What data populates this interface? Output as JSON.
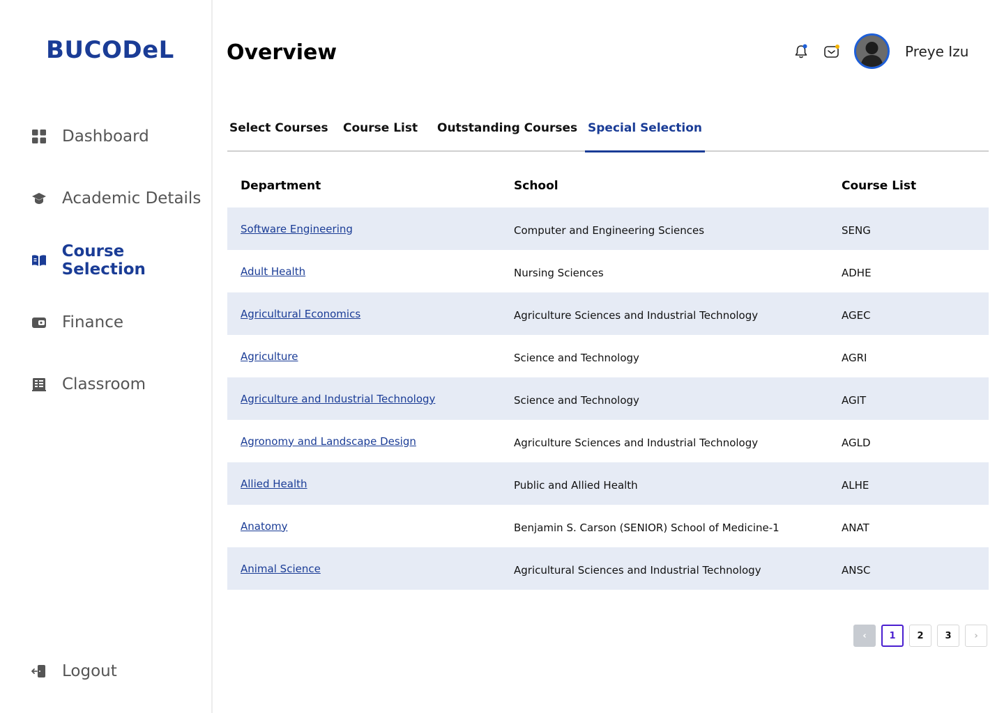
{
  "app": {
    "logo": "BUCODeL"
  },
  "sidebar": {
    "items": [
      {
        "label": "Dashboard",
        "icon": "grid-icon"
      },
      {
        "label": "Academic Details",
        "icon": "graduation-cap-icon"
      },
      {
        "label": "Course Selection",
        "icon": "open-book-icon",
        "active": true
      },
      {
        "label": "Finance",
        "icon": "wallet-icon"
      },
      {
        "label": "Classroom",
        "icon": "building-icon"
      }
    ],
    "logout": {
      "label": "Logout",
      "icon": "logout-icon"
    }
  },
  "header": {
    "title": "Overview",
    "user_name": "Preye Izu",
    "notification_dot_color": "#1e5fd8",
    "mail_dot_color": "#f5b400"
  },
  "tabs": [
    {
      "label": "Select Courses"
    },
    {
      "label": "Course List"
    },
    {
      "label": "Outstanding Courses"
    },
    {
      "label": "Special Selection",
      "active": true
    }
  ],
  "table": {
    "columns": [
      "Department",
      "School",
      "Course List"
    ],
    "rows": [
      {
        "department": "Software Engineering",
        "school": "Computer and Engineering Sciences",
        "course": "SENG"
      },
      {
        "department": "Adult Health",
        "school": "Nursing Sciences",
        "course": "ADHE"
      },
      {
        "department": "Agricultural Economics",
        "school": "Agriculture Sciences and Industrial Technology",
        "course": "AGEC"
      },
      {
        "department": "Agriculture",
        "school": "Science and Technology",
        "course": "AGRI"
      },
      {
        "department": "Agriculture and Industrial Technology",
        "school": "Science and Technology",
        "course": "AGIT"
      },
      {
        "department": "Agronomy and Landscape Design",
        "school": "Agriculture Sciences and Industrial Technology",
        "course": "AGLD"
      },
      {
        "department": "Allied Health",
        "school": "Public and Allied Health",
        "course": "ALHE"
      },
      {
        "department": "Anatomy",
        "school": "Benjamin S. Carson (SENIOR) School of Medicine-1",
        "course": "ANAT"
      },
      {
        "department": "Animal Science",
        "school": "Agricultural Sciences and Industrial Technology",
        "course": "ANSC"
      }
    ]
  },
  "pagination": {
    "pages": [
      "1",
      "2",
      "3"
    ],
    "current": "1",
    "prev_glyph": "‹",
    "next_glyph": "›"
  },
  "colors": {
    "brand": "#1a3c96",
    "row_shade": "#e6ebf5",
    "pager_active": "#4a1fd0"
  }
}
